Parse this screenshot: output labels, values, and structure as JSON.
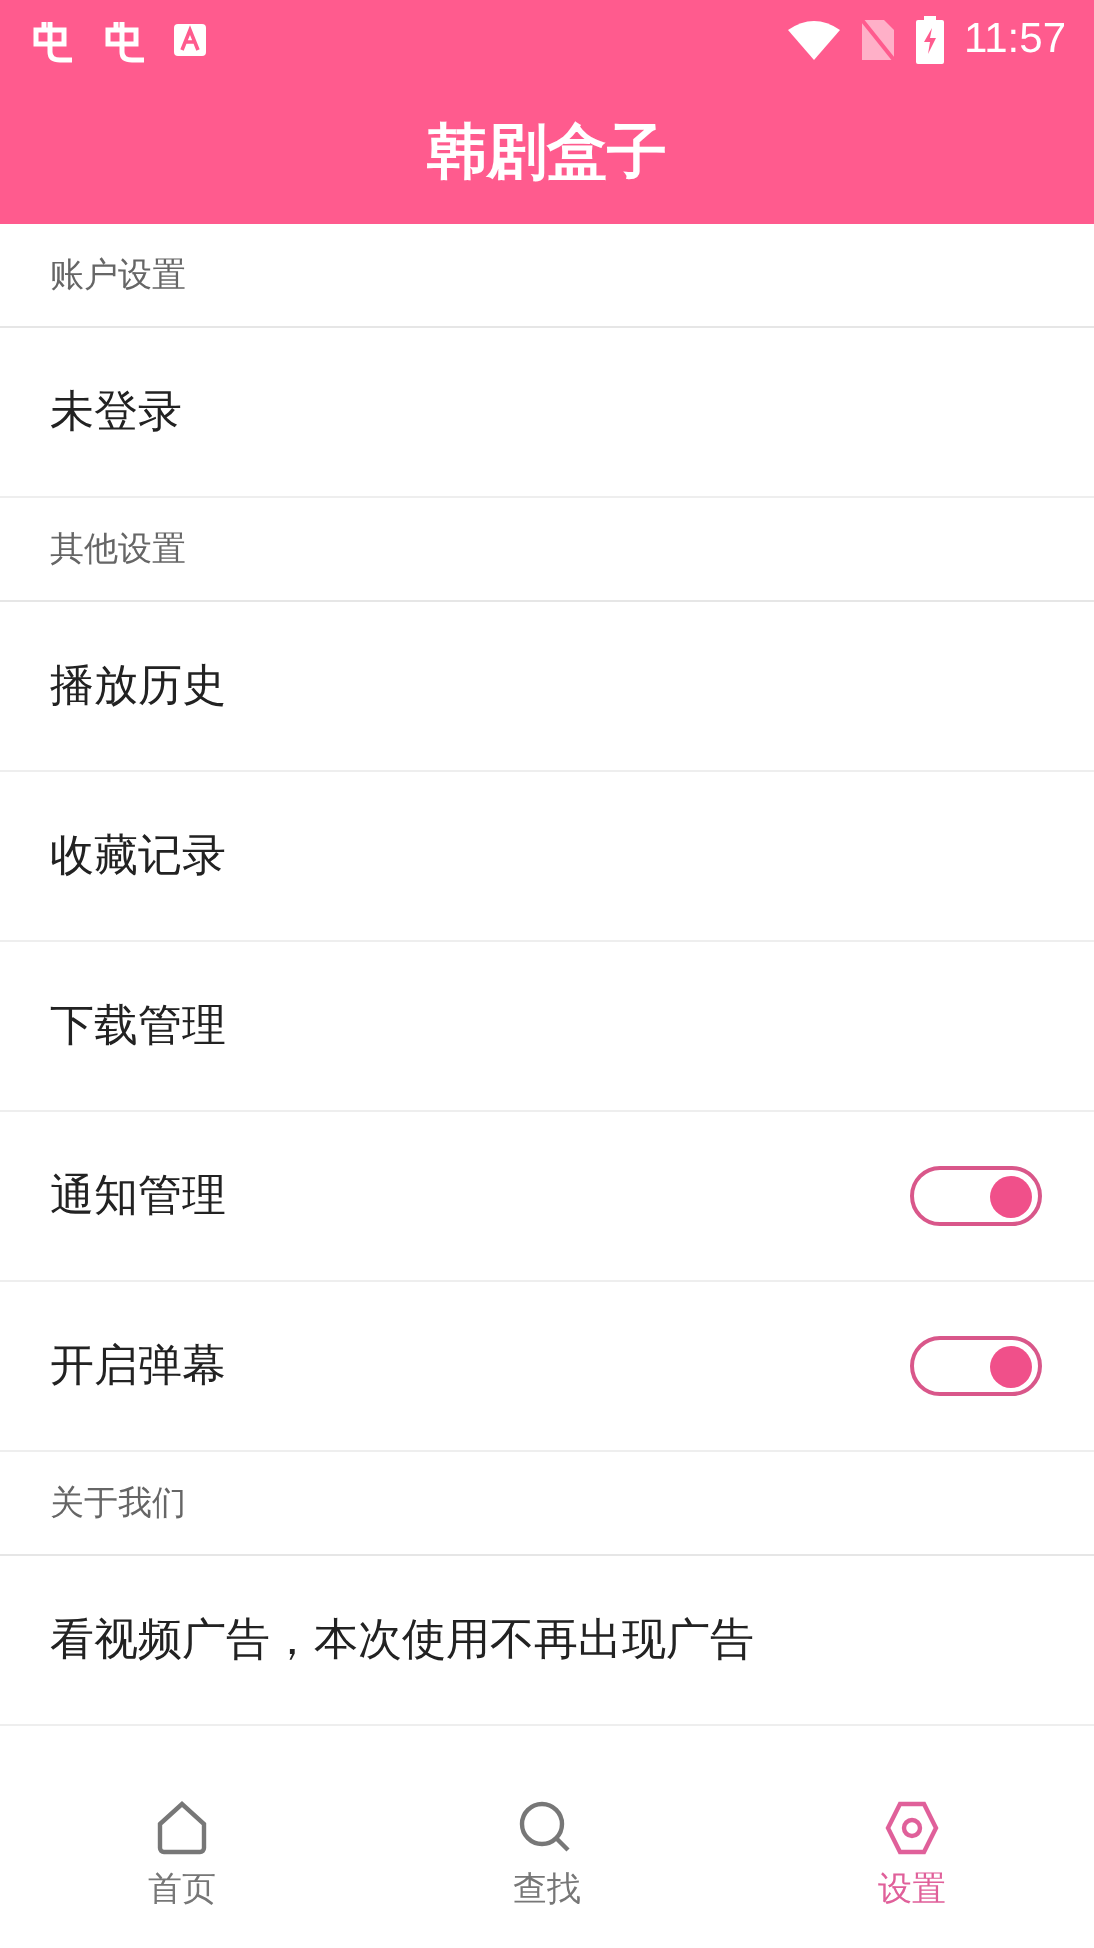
{
  "status_bar": {
    "time": "11:57"
  },
  "title": "韩剧盒子",
  "sections": [
    {
      "header": "账户设置",
      "items": [
        {
          "label": "未登录",
          "kind": "plain"
        }
      ]
    },
    {
      "header": "其他设置",
      "items": [
        {
          "label": "播放历史",
          "kind": "plain"
        },
        {
          "label": "收藏记录",
          "kind": "plain"
        },
        {
          "label": "下载管理",
          "kind": "plain"
        },
        {
          "label": "通知管理",
          "kind": "toggle",
          "on": true
        },
        {
          "label": "开启弹幕",
          "kind": "toggle",
          "on": true
        }
      ]
    },
    {
      "header": "关于我们",
      "items": [
        {
          "label": "看视频广告，本次使用不再出现广告",
          "kind": "plain"
        }
      ]
    }
  ],
  "tabs": [
    {
      "label": "首页",
      "kind": "home",
      "selected": false
    },
    {
      "label": "查找",
      "kind": "search",
      "selected": false
    },
    {
      "label": "设置",
      "kind": "settings",
      "selected": true
    }
  ]
}
